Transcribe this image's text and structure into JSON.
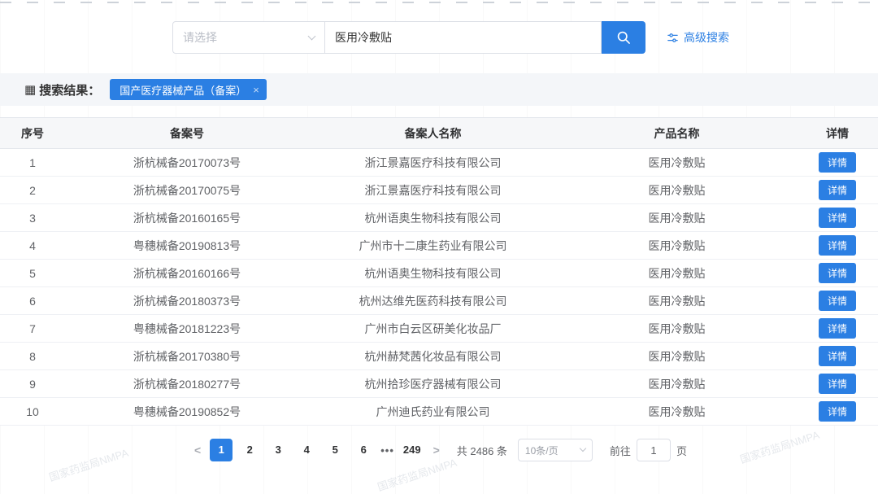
{
  "search": {
    "select_placeholder": "请选择",
    "input_value": "医用冷敷贴",
    "advanced_label": "高级搜索"
  },
  "results_bar": {
    "grid_icon": "▦",
    "label": "搜索结果：",
    "tag": "国产医疗器械产品（备案）",
    "tag_close_icon": "×"
  },
  "table": {
    "headers": [
      "序号",
      "备案号",
      "备案人名称",
      "产品名称",
      "详情"
    ],
    "detail_label": "详情",
    "rows": [
      {
        "no": "1",
        "record_no": "浙杭械备20170073号",
        "company": "浙江景嘉医疗科技有限公司",
        "product": "医用冷敷贴"
      },
      {
        "no": "2",
        "record_no": "浙杭械备20170075号",
        "company": "浙江景嘉医疗科技有限公司",
        "product": "医用冷敷贴"
      },
      {
        "no": "3",
        "record_no": "浙杭械备20160165号",
        "company": "杭州语奥生物科技有限公司",
        "product": "医用冷敷贴"
      },
      {
        "no": "4",
        "record_no": "粤穗械备20190813号",
        "company": "广州市十二康生药业有限公司",
        "product": "医用冷敷贴"
      },
      {
        "no": "5",
        "record_no": "浙杭械备20160166号",
        "company": "杭州语奥生物科技有限公司",
        "product": "医用冷敷贴"
      },
      {
        "no": "6",
        "record_no": "浙杭械备20180373号",
        "company": "杭州达维先医药科技有限公司",
        "product": "医用冷敷贴"
      },
      {
        "no": "7",
        "record_no": "粤穗械备20181223号",
        "company": "广州市白云区研美化妆品厂",
        "product": "医用冷敷贴"
      },
      {
        "no": "8",
        "record_no": "浙杭械备20170380号",
        "company": "杭州赫梵茜化妆品有限公司",
        "product": "医用冷敷贴"
      },
      {
        "no": "9",
        "record_no": "浙杭械备20180277号",
        "company": "杭州拾珍医疗器械有限公司",
        "product": "医用冷敷贴"
      },
      {
        "no": "10",
        "record_no": "粤穗械备20190852号",
        "company": "广州迪氏药业有限公司",
        "product": "医用冷敷贴"
      }
    ]
  },
  "pagination": {
    "prev_icon": "<",
    "next_icon": ">",
    "pages": [
      "1",
      "2",
      "3",
      "4",
      "5",
      "6"
    ],
    "active_page": "1",
    "ellipsis": "•••",
    "last_page": "249",
    "total_text": "共 2486 条",
    "page_size_value": "10条/页",
    "goto_prefix": "前往",
    "goto_value": "1",
    "goto_suffix": "页"
  },
  "watermark": "国家药监局NMPA",
  "colors": {
    "primary_blue": "#2b7fe3",
    "results_bar_bg": "#f4f6f9"
  }
}
